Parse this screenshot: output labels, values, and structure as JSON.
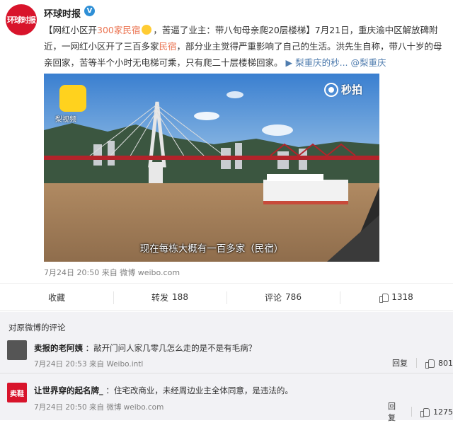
{
  "poster": {
    "name": "环球时报",
    "avatar_text": "环球时报"
  },
  "post": {
    "text_part1": "【网红小区开",
    "text_red1": "300家民宿",
    "text_part2": "，苦逼了业主：带八旬母亲爬20层楼梯】7月21日，重庆渝中区解放碑附近，一网红小区开了三百多家",
    "text_red2": "民宿",
    "text_part3": "，部分业主觉得严重影响了自己的生活。洪先生自称，带八十岁的母亲回家，苦等半个小时无电梯可乘，只有爬二十层楼梯回家。",
    "link1": "梨重庆的秒...",
    "link2": "@梨重庆"
  },
  "video": {
    "app_label": "梨视频",
    "watermark": "秒拍",
    "subtitle": "现在每栋大概有一百多家（民宿）"
  },
  "meta": {
    "time": "7月24日 20:50",
    "source_prefix": "来自",
    "source": "微博 weibo.com"
  },
  "actions": {
    "favorite": "收藏",
    "repost_label": "转发",
    "repost_count": "188",
    "comment_label": "评论",
    "comment_count": "786",
    "like_count": "1318"
  },
  "comments_title": "对原微博的评论",
  "comments": [
    {
      "user": "卖报的老阿姨",
      "text": "：敲开门问人家几零几怎么走的是不是有毛病？",
      "time": "7月24日 20:53",
      "source_prefix": "来自",
      "source": "Weibo.intl",
      "reply": "回复",
      "likes": "801"
    },
    {
      "user": "让世界穿的起名牌_",
      "avatar_text": "卖鞋",
      "text": "：住宅改商业，未经周边业主全体同意，是违法的。",
      "time": "7月24日 20:50",
      "source_prefix": "来自",
      "source": "微博 weibo.com",
      "reply": "回复",
      "likes": "1275"
    }
  ],
  "colors": {
    "accent_red": "#eb7350",
    "link_blue": "#507daf",
    "brand_red": "#d8142b",
    "comments_bg": "#f2f2f5"
  }
}
